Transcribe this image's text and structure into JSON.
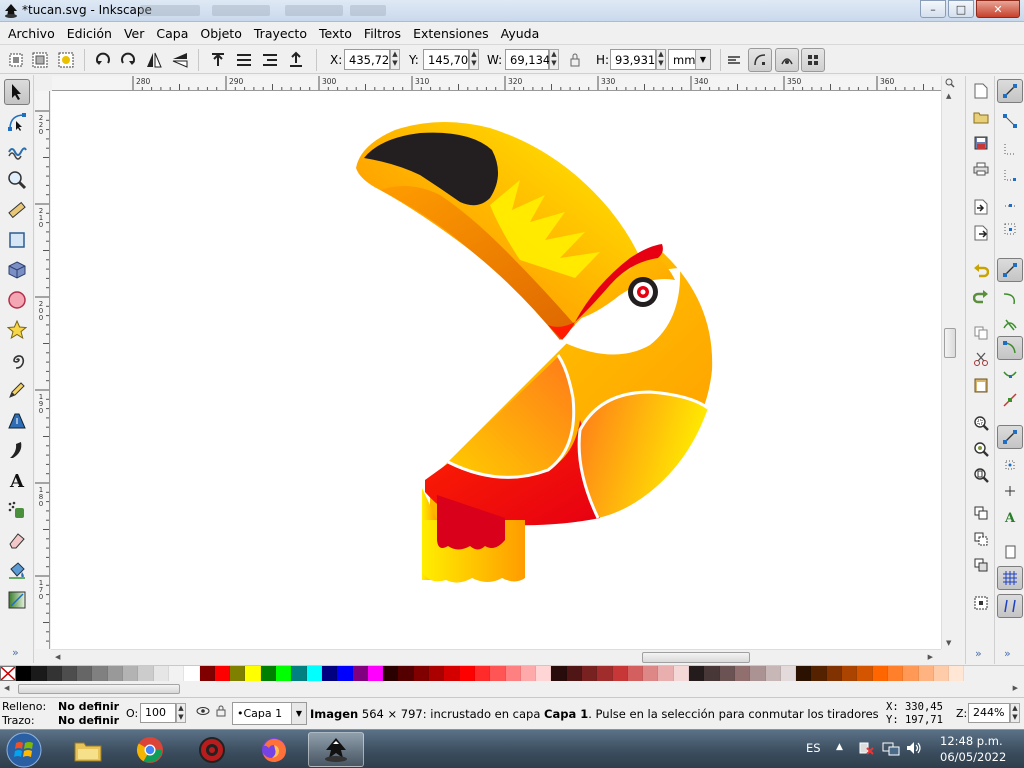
{
  "window": {
    "title": "*tucan.svg - Inkscape",
    "minimize": "–",
    "maximize": "□",
    "close": "✕"
  },
  "menu": [
    {
      "label": "Archivo",
      "key": "archivo"
    },
    {
      "label": "Edición",
      "key": "edicion"
    },
    {
      "label": "Ver",
      "key": "ver"
    },
    {
      "label": "Capa",
      "key": "capa"
    },
    {
      "label": "Objeto",
      "key": "objeto"
    },
    {
      "label": "Trayecto",
      "key": "trayecto"
    },
    {
      "label": "Texto",
      "key": "texto"
    },
    {
      "label": "Filtros",
      "key": "filtros"
    },
    {
      "label": "Extensiones",
      "key": "extensiones"
    },
    {
      "label": "Ayuda",
      "key": "ayuda"
    }
  ],
  "controls": {
    "x_label": "X:",
    "x_value": "435,721",
    "y_label": "Y:",
    "y_value": "145,706",
    "w_label": "W:",
    "w_value": "69,134",
    "h_label": "H:",
    "h_value": "93,931",
    "unit": "mm"
  },
  "ruler": {
    "top_labels": [
      "280",
      "290",
      "300",
      "310",
      "320",
      "330",
      "340",
      "350",
      "360"
    ],
    "left_labels": [
      "220",
      "210",
      "200",
      "190",
      "180",
      "170"
    ]
  },
  "palette": {
    "colors": [
      "#000000",
      "#1a1a1a",
      "#333333",
      "#4d4d4d",
      "#666666",
      "#808080",
      "#999999",
      "#b3b3b3",
      "#cccccc",
      "#e6e6e6",
      "#f2f2f2",
      "#ffffff",
      "#800000",
      "#ff0000",
      "#808000",
      "#ffff00",
      "#008000",
      "#00ff00",
      "#008080",
      "#00ffff",
      "#000080",
      "#0000ff",
      "#800080",
      "#ff00ff",
      "#2b0000",
      "#550000",
      "#800000",
      "#aa0000",
      "#d40000",
      "#ff0000",
      "#ff2a2a",
      "#ff5555",
      "#ff8080",
      "#ffaaaa",
      "#ffd5d5",
      "#280b0b",
      "#501616",
      "#782121",
      "#a02c2c",
      "#c83737",
      "#d35f5f",
      "#de8787",
      "#e9afaf",
      "#f4d7d7",
      "#241c1c",
      "#483737",
      "#6c5353",
      "#916f6f",
      "#ac9393",
      "#c8b7b7",
      "#e3dbdb",
      "#2b1100",
      "#552200",
      "#803300",
      "#aa4400",
      "#d45500",
      "#ff6600",
      "#ff7f2a",
      "#ff9955",
      "#ffb380",
      "#ffccaa",
      "#ffe6d5"
    ]
  },
  "status": {
    "fill_label": "Relleno:",
    "fill_value": "No definir",
    "stroke_label": "Trazo:",
    "stroke_value": "No definir",
    "opacity_label": "O:",
    "opacity_value": "100",
    "layer": "•Capa 1",
    "message_bold": "Imagen",
    "message_mid": " 564 × 797: incrustado en capa ",
    "message_layer": "Capa 1",
    "message_tail": ". Pulse en la selección para conmutar los tiradores de escalad...",
    "coord_x_label": "X:",
    "coord_x": "330,45",
    "coord_y_label": "Y:",
    "coord_y": "197,71",
    "zoom_label": "Z:",
    "zoom": "244%"
  },
  "taskbar": {
    "language": "ES",
    "time": "12:48 p.m.",
    "date": "06/05/2022",
    "apps": [
      "explorer-icon",
      "chrome-icon",
      "shield-app-icon",
      "firefox-icon",
      "inkscape-icon"
    ]
  },
  "colors": {
    "accent": "#4a6fae",
    "toucan_black": "#231f20",
    "toucan_red": "#ff1a00",
    "toucan_yellow": "#ffee00",
    "toucan_orange": "#ff8a00"
  }
}
